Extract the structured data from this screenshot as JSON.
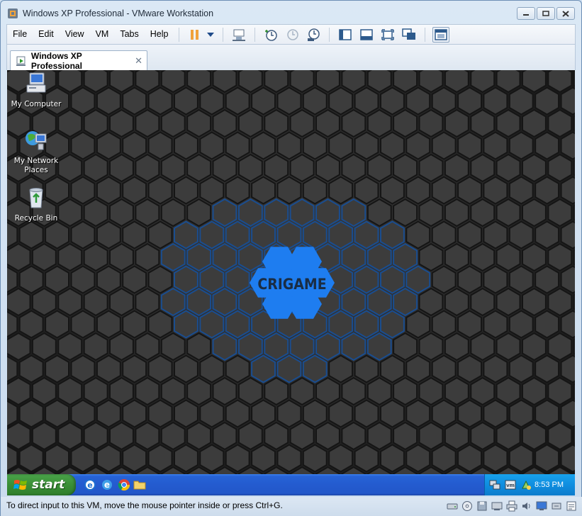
{
  "window": {
    "title": "Windows XP Professional - VMware Workstation"
  },
  "menu": {
    "items": [
      "File",
      "Edit",
      "View",
      "VM",
      "Tabs",
      "Help"
    ]
  },
  "toolbar": {
    "icons": [
      "pause-icon",
      "dropdown-icon",
      "send-ctrl-alt-del-icon",
      "snapshot-icon",
      "revert-snapshot-icon",
      "snapshot-manager-icon",
      "show-library-icon",
      "thumbnail-bar-icon",
      "full-screen-icon",
      "unity-icon",
      "console-view-icon"
    ]
  },
  "tab": {
    "label": "Windows XP Professional",
    "close_glyph": "✕"
  },
  "desktop": {
    "icons": [
      {
        "label": "My Computer"
      },
      {
        "label": "My Network Places"
      },
      {
        "label": "Recycle Bin"
      }
    ],
    "wallpaper_text": "CRIGAME"
  },
  "taskbar": {
    "start_label": "start",
    "clock": "8:53 PM",
    "colors": {
      "taskbar": "#245bcf",
      "start": "#3a8f36",
      "tray": "#0f8ee0"
    }
  },
  "statusbar": {
    "text": "To direct input to this VM, move the mouse pointer inside or press Ctrl+G."
  }
}
